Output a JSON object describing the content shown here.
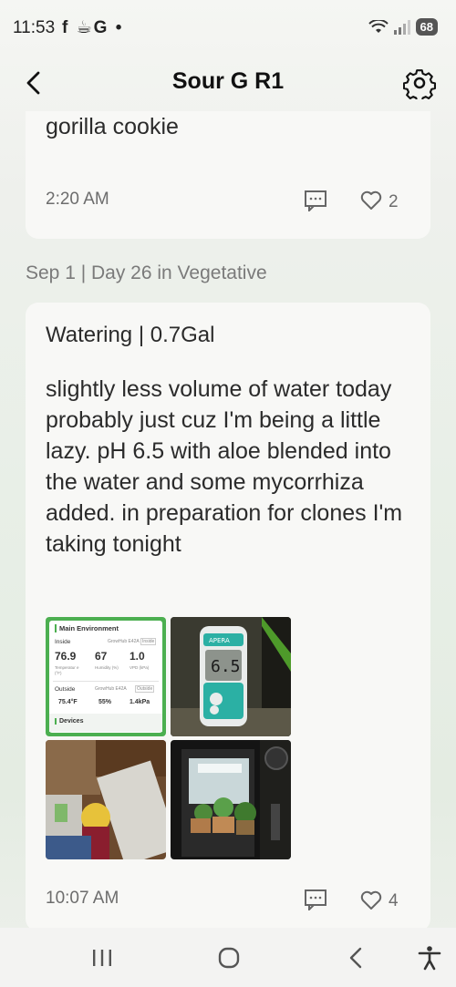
{
  "status_bar": {
    "time": "11:53",
    "left_icons": "f ☕G •",
    "battery": "68"
  },
  "header": {
    "title": "Sour G R1"
  },
  "previous_entry": {
    "text": "gorilla cookie",
    "time": "2:20 AM",
    "likes": "2"
  },
  "date_header": "Sep 1 | Day 26 in Vegetative",
  "entry": {
    "title": "Watering | 0.7Gal",
    "text": "slightly less volume of water today probably just cuz I'm being a little lazy. pH 6.5 with aloe blended into the water and some mycorrhiza added. in preparation for clones I'm taking tonight",
    "time": "10:07 AM",
    "likes": "4"
  },
  "photo_env": {
    "heading": "Main Environment",
    "inside_label": "Inside",
    "device": "GrowHub E42A",
    "inside_tag": "Inside",
    "temp": "76.9",
    "humidity": "67",
    "vpd": "1.0",
    "temp_label": "Temperatur e (°F)",
    "humidity_label": "Humidity (%)",
    "vpd_label": "VPD (kPa)",
    "outside_label": "Outside",
    "outside_tag": "Outside",
    "out_temp": "75.4°F",
    "out_humidity": "55%",
    "out_vpd": "1.4kPa",
    "devices": "Devices"
  },
  "photo_meter": {
    "brand": "APERA",
    "reading": "6.5"
  },
  "colors": {
    "accent_green": "#4caf50",
    "text": "#2b2b2b",
    "muted": "#6d6d6d"
  }
}
